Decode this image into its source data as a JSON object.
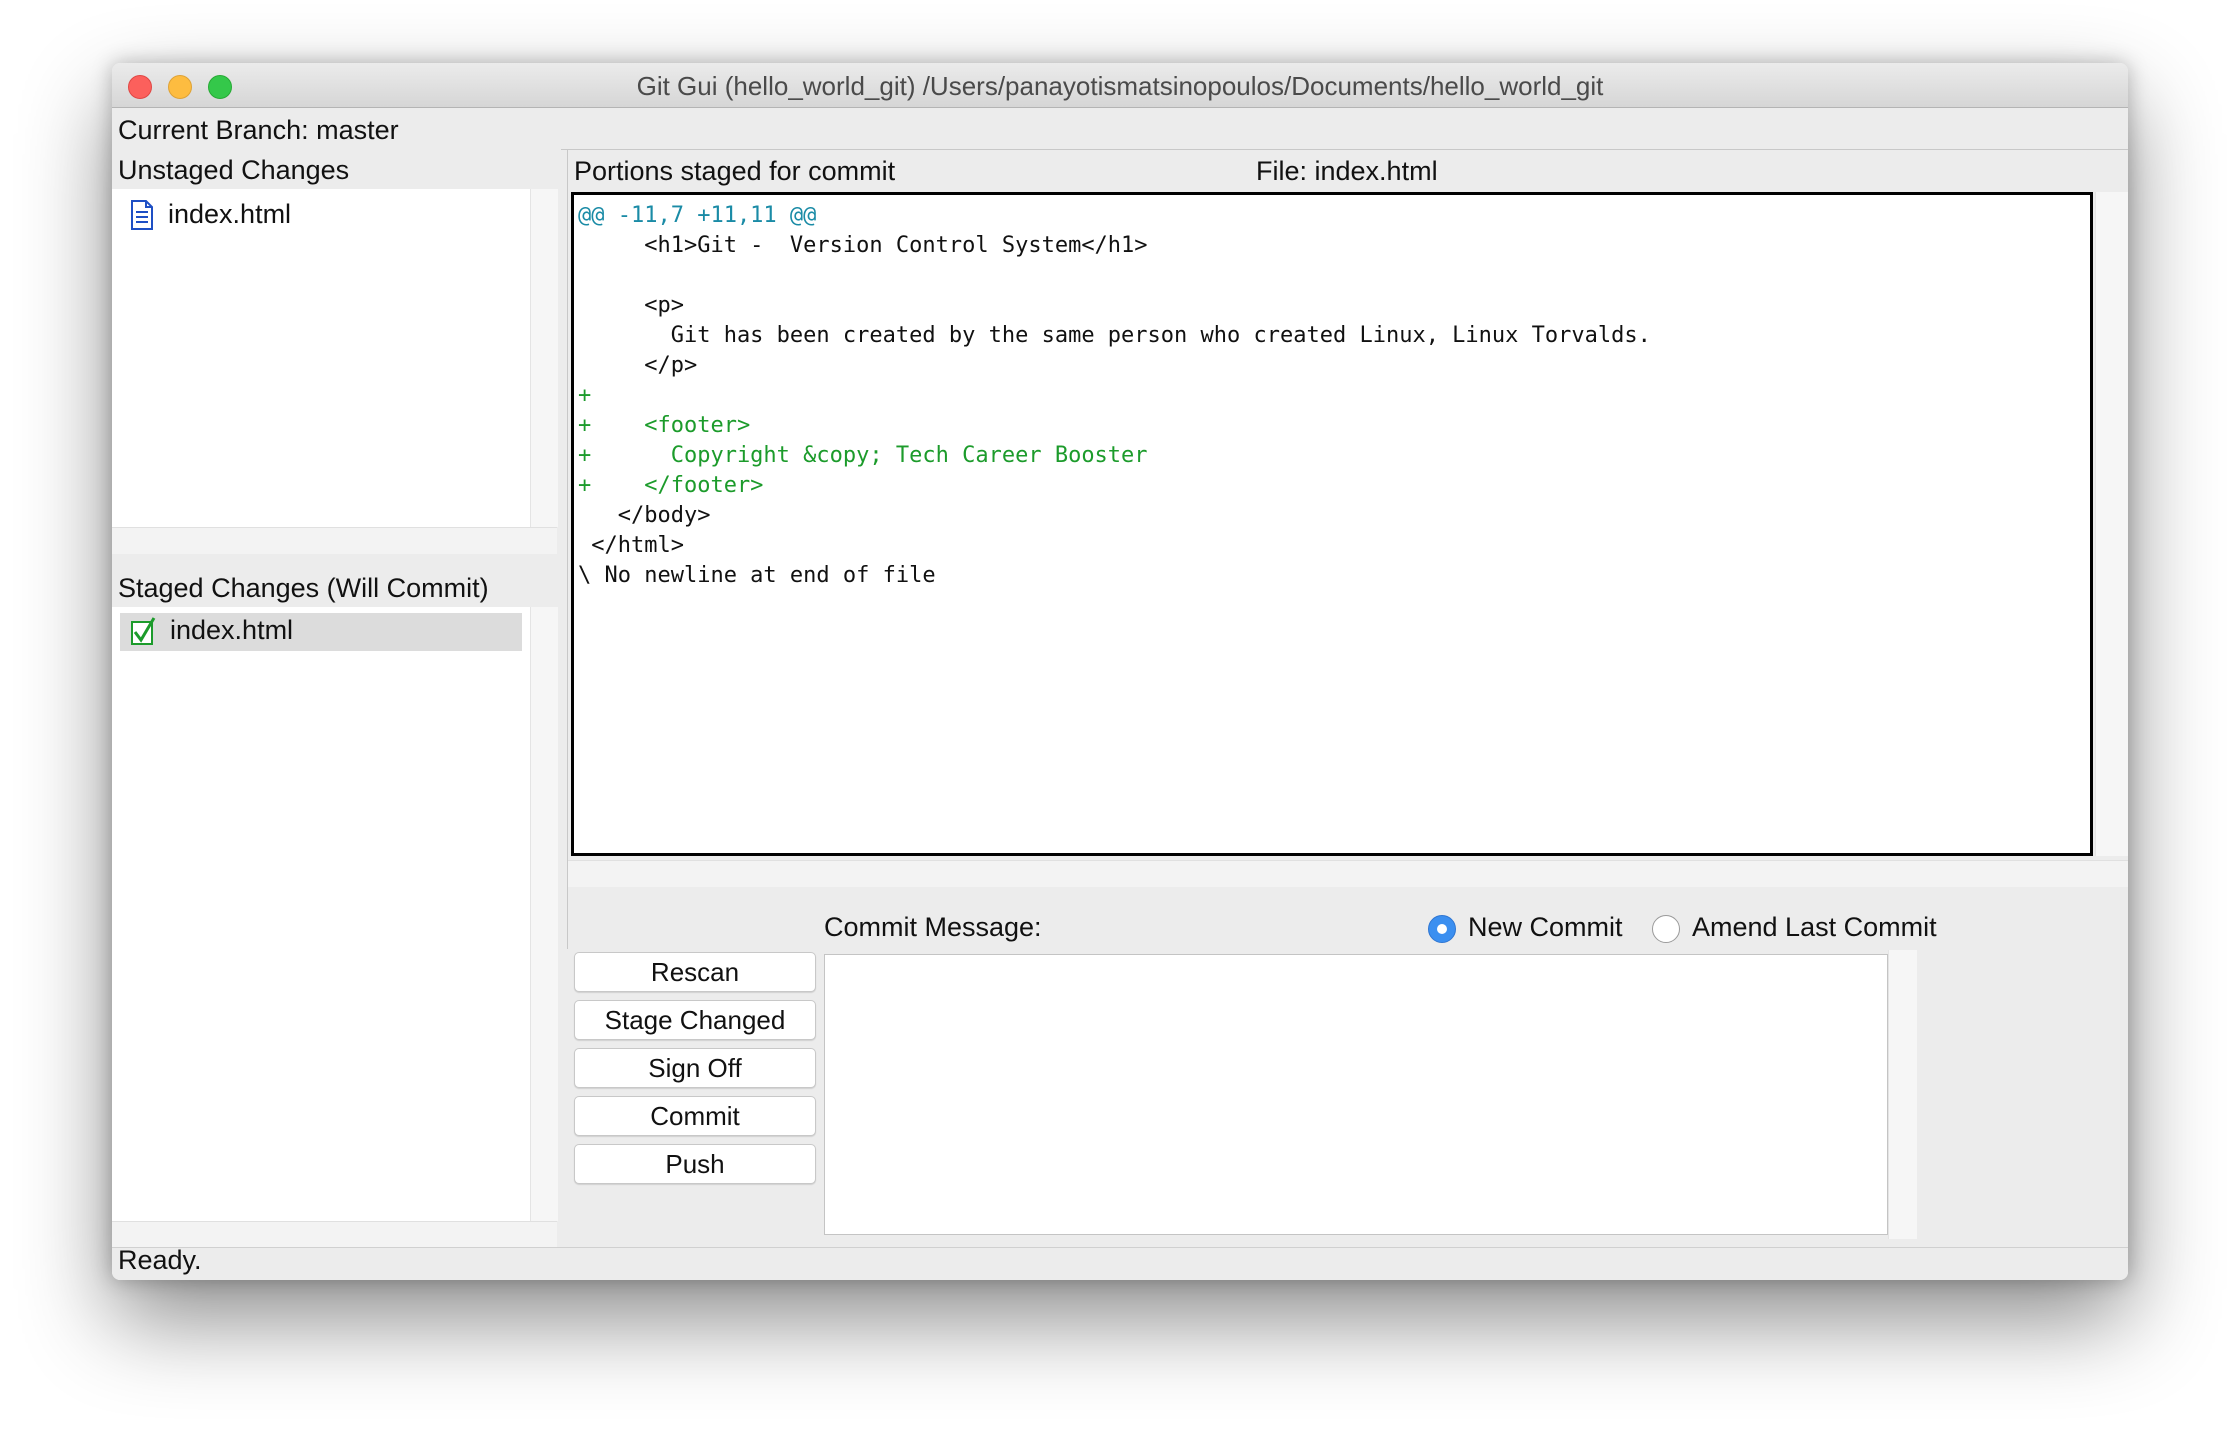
{
  "window": {
    "title": "Git Gui (hello_world_git) /Users/panayotismatsinopoulos/Documents/hello_world_git"
  },
  "branch": {
    "label": "Current Branch: master"
  },
  "unstaged": {
    "header": "Unstaged Changes",
    "files": [
      {
        "name": "index.html",
        "icon": "file-document-icon"
      }
    ]
  },
  "staged": {
    "header": "Staged Changes (Will Commit)",
    "files": [
      {
        "name": "index.html",
        "icon": "checkbox-checked-icon"
      }
    ]
  },
  "diff": {
    "header": "Portions staged for commit",
    "file_label": "File: index.html",
    "lines": [
      {
        "type": "hunk",
        "text": "@@ -11,7 +11,11 @@"
      },
      {
        "type": "ctx",
        "text": "     <h1>Git -  Version Control System</h1>"
      },
      {
        "type": "ctx",
        "text": ""
      },
      {
        "type": "ctx",
        "text": "     <p>"
      },
      {
        "type": "ctx",
        "text": "       Git has been created by the same person who created Linux, Linux Torvalds."
      },
      {
        "type": "ctx",
        "text": "     </p>"
      },
      {
        "type": "add",
        "text": "+"
      },
      {
        "type": "add",
        "text": "+    <footer>"
      },
      {
        "type": "add",
        "text": "+      Copyright &copy; Tech Career Booster"
      },
      {
        "type": "add",
        "text": "+    </footer>"
      },
      {
        "type": "ctx",
        "text": "   </body>"
      },
      {
        "type": "ctx",
        "text": " </html>"
      },
      {
        "type": "ctx",
        "text": "\\ No newline at end of file"
      }
    ]
  },
  "actions": {
    "rescan": "Rescan",
    "stage_changed": "Stage Changed",
    "sign_off": "Sign Off",
    "commit": "Commit",
    "push": "Push"
  },
  "commit": {
    "label": "Commit Message:",
    "new_commit": "New Commit",
    "amend": "Amend Last Commit",
    "message": "",
    "selected": "new_commit"
  },
  "status": {
    "text": "Ready."
  },
  "colors": {
    "hunk": "#1a8ba6",
    "added": "#1c9b2b",
    "radio_selected": "#3b8ff0"
  }
}
